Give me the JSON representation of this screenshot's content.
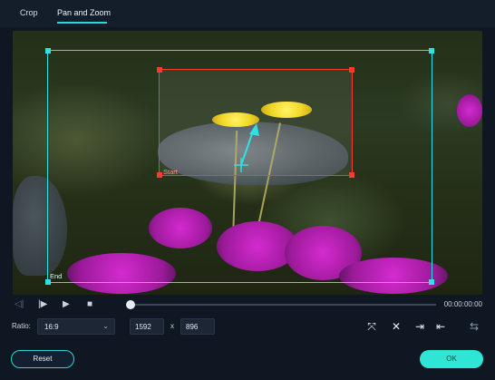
{
  "tabs": [
    {
      "label": "Crop"
    },
    {
      "label": "Pan and Zoom"
    }
  ],
  "preview": {
    "start_label": "Start",
    "end_label": "End"
  },
  "playback": {
    "time": "00:00:00:00",
    "progress": 0
  },
  "ratio": {
    "label": "Ratio:",
    "value": "16:9",
    "width": "1592",
    "height": "896",
    "x": "x"
  },
  "buttons": {
    "reset": "Reset",
    "ok": "OK"
  },
  "colors": {
    "accent": "#2fe1e3",
    "start_frame": "#ff3b2b",
    "end_frame": "#2fe1e3"
  },
  "icons": [
    "prev-frame-icon",
    "step-forward-icon",
    "play-icon",
    "stop-icon",
    "fit-icon",
    "swap-crop-icon",
    "set-end-icon",
    "set-start-icon",
    "flip-icon"
  ]
}
